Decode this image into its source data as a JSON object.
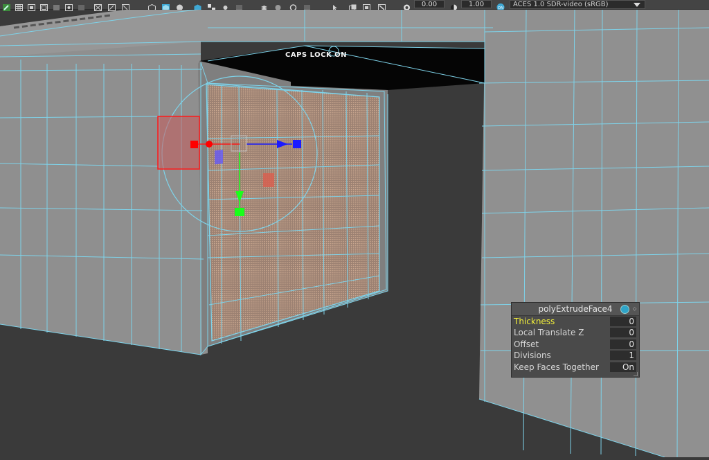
{
  "toolbar": {
    "exposure_value": "0.00",
    "gamma_value": "1.00",
    "colorspace_toggle": "ON",
    "colorspace_label": "ACES 1.0 SDR-video (sRGB)",
    "icons": [
      "pencil-icon",
      "grid-icon",
      "film-gate-icon",
      "resolution-gate-icon",
      "field-chart-icon",
      "safe-action-icon",
      "wireframe-icon",
      "smooth-shade-icon",
      "shaded-wireframe-icon",
      "textured-icon",
      "checker-icon",
      "lights-icon",
      "shadows-icon",
      "ambient-occlusion-icon",
      "motion-blur-icon",
      "isolate-icon",
      "xray-icon",
      "xray-joints-icon",
      "xray-components-icon",
      "exposure-icon",
      "gamma-icon",
      "colorspace-toggle-icon"
    ],
    "accent_color": "#3fa8d4"
  },
  "viewport": {
    "caps_lock_label": "CAPS LOCK ON",
    "wire_color": "#7ed3ea",
    "manipulator_colors": {
      "x": "#ff1a1a",
      "y": "#19ff19",
      "z": "#1a1aff"
    }
  },
  "channel_box": {
    "title": "polyExtrudeFace4",
    "rows": [
      {
        "label": "Thickness",
        "value": "0",
        "highlight": true
      },
      {
        "label": "Local Translate Z",
        "value": "0",
        "highlight": false
      },
      {
        "label": "Offset",
        "value": "0",
        "highlight": false
      },
      {
        "label": "Divisions",
        "value": "1",
        "highlight": false
      },
      {
        "label": "Keep Faces Together",
        "value": "On",
        "highlight": false
      }
    ]
  }
}
